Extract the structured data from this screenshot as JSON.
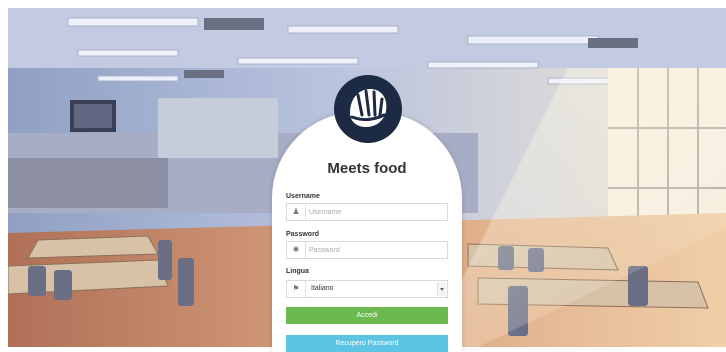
{
  "login": {
    "title": "Meets food",
    "username_label": "Username",
    "username_placeholder": "Username",
    "password_label": "Password",
    "password_placeholder": "Password",
    "language_label": "Lingua",
    "language_value": "Italiano",
    "submit_label": "Accedi",
    "recover_label": "Recupero Password"
  },
  "icons": {
    "logo": "hand-logo-icon",
    "username": "user-icon",
    "password": "asterisk-icon",
    "language": "flag-icon"
  },
  "colors": {
    "brand": "#1c2a44",
    "primary_button": "#6cb94f",
    "secondary_button": "#5ec4e3"
  }
}
